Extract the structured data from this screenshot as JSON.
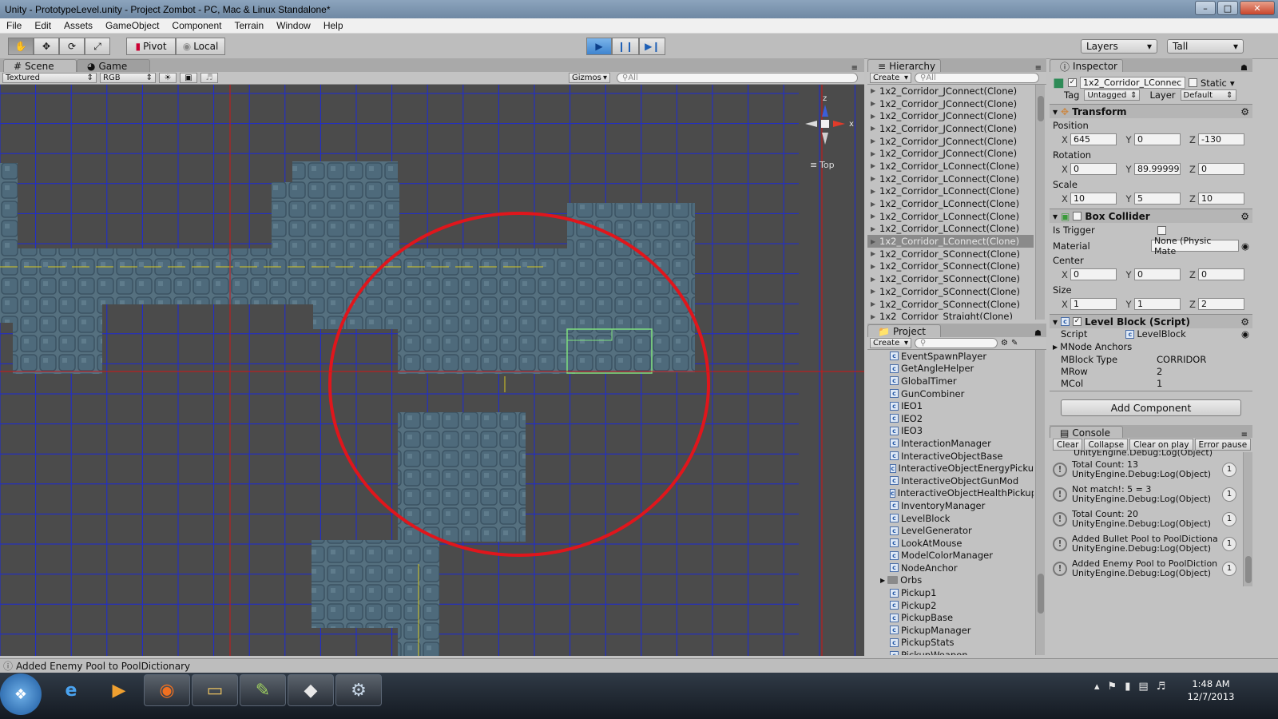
{
  "window": {
    "title": "Unity - PrototypeLevel.unity - Project Zombot - PC, Mac & Linux Standalone*"
  },
  "menu": [
    "File",
    "Edit",
    "Assets",
    "GameObject",
    "Component",
    "Terrain",
    "Window",
    "Help"
  ],
  "toolbar": {
    "pivot_label": "Pivot",
    "local_label": "Local",
    "layers_label": "Layers",
    "layout_label": "Tall"
  },
  "scene": {
    "tab_scene": "Scene",
    "tab_game": "Game",
    "render_mode": "Textured",
    "color_mode": "RGB",
    "gizmos_label": "Gizmos",
    "search_placeholder": "All",
    "view_label": "Top",
    "axis_z": "z",
    "axis_x": "x"
  },
  "hierarchy": {
    "title": "Hierarchy",
    "create_label": "Create",
    "search_placeholder": "All",
    "items": [
      "1x2_Corridor_JConnect(Clone)",
      "1x2_Corridor_JConnect(Clone)",
      "1x2_Corridor_JConnect(Clone)",
      "1x2_Corridor_JConnect(Clone)",
      "1x2_Corridor_JConnect(Clone)",
      "1x2_Corridor_JConnect(Clone)",
      "1x2_Corridor_LConnect(Clone)",
      "1x2_Corridor_LConnect(Clone)",
      "1x2_Corridor_LConnect(Clone)",
      "1x2_Corridor_LConnect(Clone)",
      "1x2_Corridor_LConnect(Clone)",
      "1x2_Corridor_LConnect(Clone)",
      "1x2_Corridor_LConnect(Clone)",
      "1x2_Corridor_SConnect(Clone)",
      "1x2_Corridor_SConnect(Clone)",
      "1x2_Corridor_SConnect(Clone)",
      "1x2_Corridor_SConnect(Clone)",
      "1x2_Corridor_SConnect(Clone)",
      "1x2_Corridor_Straight(Clone)"
    ],
    "selected_index": 12
  },
  "project": {
    "title": "Project",
    "create_label": "Create",
    "items": [
      "EventSpawnPlayer",
      "GetAngleHelper",
      "GlobalTimer",
      "GunCombiner",
      "IEO1",
      "IEO2",
      "IEO3",
      "InteractionManager",
      "InteractiveObjectBase",
      "InteractiveObjectEnergyPicku",
      "InteractiveObjectGunMod",
      "InteractiveObjectHealthPickup",
      "InventoryManager",
      "LevelBlock",
      "LevelGenerator",
      "LookAtMouse",
      "ModelColorManager",
      "NodeAnchor",
      "Orbs",
      "Pickup1",
      "Pickup2",
      "PickupBase",
      "PickupManager",
      "PickupStats",
      "PickupWeapon"
    ]
  },
  "inspector": {
    "title": "Inspector",
    "object_name": "1x2_Corridor_LConnec",
    "static_label": "Static",
    "tag_label": "Tag",
    "tag_value": "Untagged",
    "layer_label": "Layer",
    "layer_value": "Default",
    "transform": {
      "title": "Transform",
      "position_label": "Position",
      "position": {
        "x": "645",
        "y": "0",
        "z": "-130"
      },
      "rotation_label": "Rotation",
      "rotation": {
        "x": "0",
        "y": "89.99999",
        "z": "0"
      },
      "scale_label": "Scale",
      "scale": {
        "x": "10",
        "y": "5",
        "z": "10"
      }
    },
    "box_collider": {
      "title": "Box Collider",
      "is_trigger_label": "Is Trigger",
      "material_label": "Material",
      "material_value": "None (Physic Mate",
      "center_label": "Center",
      "center": {
        "x": "0",
        "y": "0",
        "z": "0"
      },
      "size_label": "Size",
      "size": {
        "x": "1",
        "y": "1",
        "z": "2"
      }
    },
    "level_block": {
      "title": "Level Block (Script)",
      "script_label": "Script",
      "script_value": "LevelBlock",
      "mnode_anchors_label": "MNode Anchors",
      "mblock_type_label": "MBlock Type",
      "mblock_type_value": "CORRIDOR",
      "mrow_label": "MRow",
      "mrow_value": "2",
      "mcol_label": "MCol",
      "mcol_value": "1"
    },
    "add_component_label": "Add Component"
  },
  "console": {
    "title": "Console",
    "buttons": [
      "Clear",
      "Collapse",
      "Clear on play",
      "Error pause"
    ],
    "top_partial": "UnityEngine.Debug:Log(Object)",
    "entries": [
      {
        "line1": "Total Count: 13",
        "line2": "UnityEngine.Debug:Log(Object)",
        "count": "1"
      },
      {
        "line1": "Not match!: 5 = 3",
        "line2": "UnityEngine.Debug:Log(Object)",
        "count": "1"
      },
      {
        "line1": "Total Count: 20",
        "line2": "UnityEngine.Debug:Log(Object)",
        "count": "1"
      },
      {
        "line1": "Added Bullet Pool to PoolDictiona",
        "line2": "UnityEngine.Debug:Log(Object)",
        "count": "1"
      },
      {
        "line1": "Added Enemy Pool to PoolDiction",
        "line2": "UnityEngine.Debug:Log(Object)",
        "count": "1"
      }
    ]
  },
  "status": {
    "message": "Added Enemy Pool to PoolDictionary"
  },
  "taskbar": {
    "time": "1:48 AM",
    "date": "12/7/2013"
  },
  "colors": {
    "scene_bg": "#4b4b4b",
    "grid": "#1d2bd6",
    "highlight_circle": "#e0161c",
    "selection_green": "#7fe07f"
  }
}
